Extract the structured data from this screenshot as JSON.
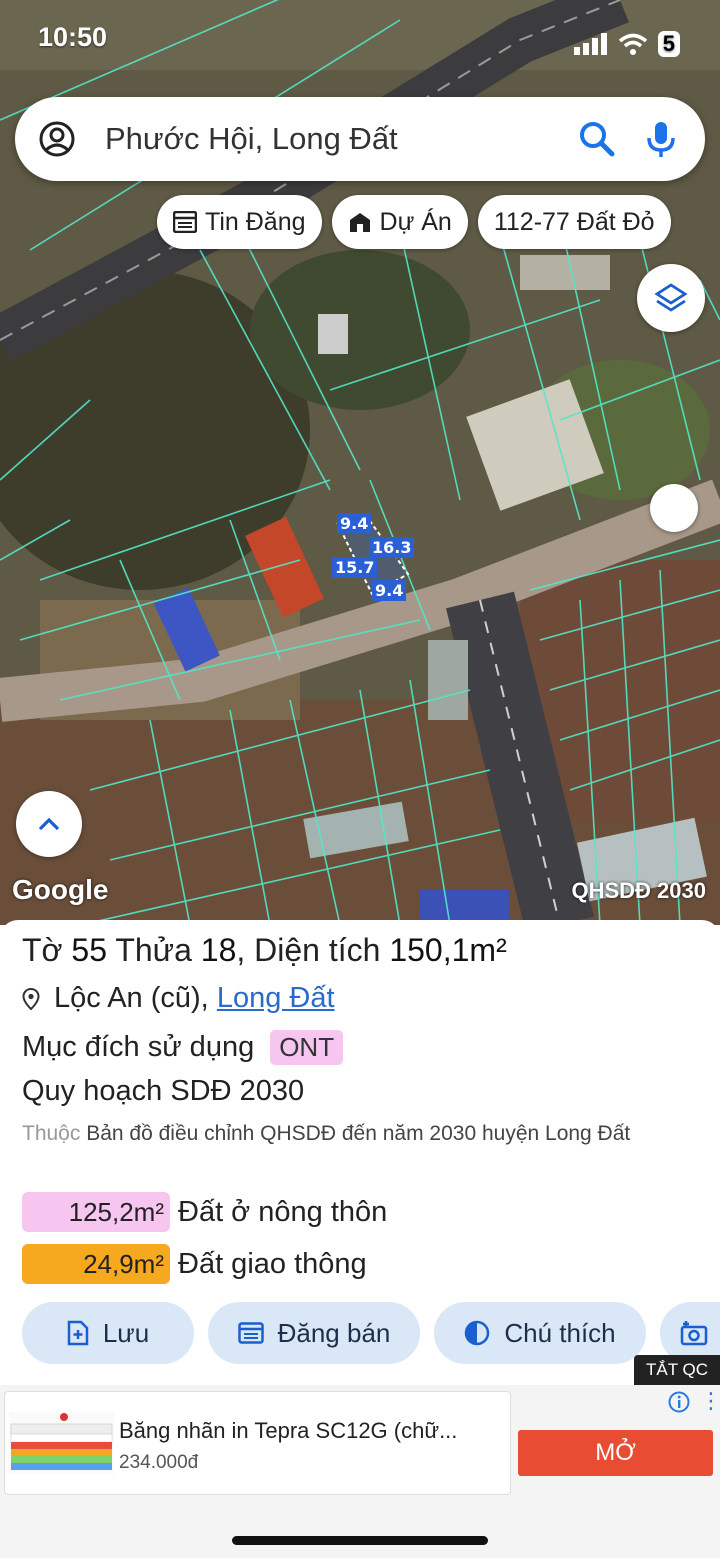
{
  "status_bar": {
    "time": "10:50",
    "battery": "5"
  },
  "search": {
    "text": "Phước Hội, Long Đất"
  },
  "chips": [
    {
      "label": "Tin Đăng",
      "icon": "listing-icon"
    },
    {
      "label": "Dự Án",
      "icon": "building-icon"
    },
    {
      "label": "112-77 Đất Đỏ",
      "icon": ""
    }
  ],
  "map": {
    "measurements": [
      "9.4",
      "16.3",
      "15.7",
      "9.4"
    ],
    "google_logo": "Google",
    "plan_label": "QHSDĐ 2030"
  },
  "panel": {
    "title_prefix": "Tờ ",
    "sheet": "55",
    "title_mid": " Thửa ",
    "parcel": "18",
    "title_area_prefix": ", Diện tích ",
    "area": "150,1m²",
    "location_text": "Lộc An (cũ), ",
    "location_link": "Long Đất",
    "purpose_label": "Mục đích sử dụng",
    "purpose_code": "ONT",
    "plan_title": "Quy hoạch SDĐ 2030",
    "belong_prefix": "Thuộc",
    "belong_text": " Bản đồ điều chỉnh QHSDĐ đến năm 2030 huyện Long Đất",
    "areas": [
      {
        "value": "125,2m²",
        "label": "Đất ở nông thôn",
        "color": "#f6c6f0"
      },
      {
        "value": "24,9m²",
        "label": "Đất giao thông",
        "color": "#f6a81f"
      }
    ],
    "actions": [
      {
        "label": "Lưu"
      },
      {
        "label": "Đăng bán"
      },
      {
        "label": "Chú thích"
      }
    ],
    "ad_toggle": "TẮT QC"
  },
  "ad": {
    "title": "Băng nhãn in Tepra SC12G (chữ...",
    "price": "234.000đ",
    "button": "MỞ"
  }
}
